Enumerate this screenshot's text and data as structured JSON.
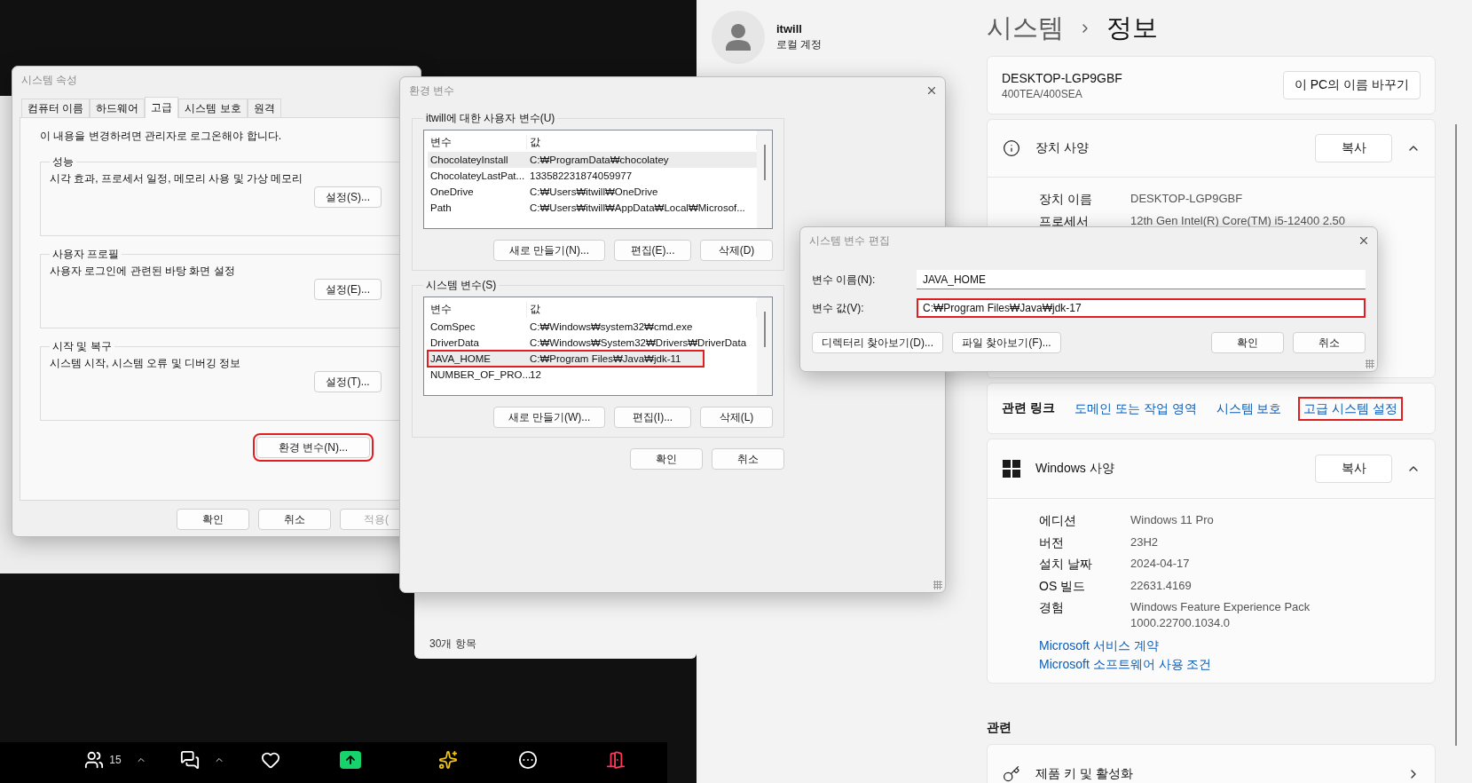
{
  "background_window": {
    "status": "30개 항목"
  },
  "system_properties": {
    "title": "시스템 속성",
    "tabs": [
      {
        "label": "컴퓨터 이름",
        "selected": false
      },
      {
        "label": "하드웨어",
        "selected": false
      },
      {
        "label": "고급",
        "selected": true
      },
      {
        "label": "시스템 보호",
        "selected": false
      },
      {
        "label": "원격",
        "selected": false
      }
    ],
    "notice": "이 내용을 변경하려면 관리자로 로그온해야 합니다.",
    "groups": [
      {
        "title": "성능",
        "description": "시각 효과, 프로세서 일정, 메모리 사용 및 가상 메모리",
        "button": "설정(S)..."
      },
      {
        "title": "사용자 프로필",
        "description": "사용자 로그인에 관련된 바탕 화면 설정",
        "button": "설정(E)..."
      },
      {
        "title": "시작 및 복구",
        "description": "시스템 시작, 시스템 오류 및 디버깅 정보",
        "button": "설정(T)..."
      }
    ],
    "env_button": {
      "label": "환경 변수(N)...",
      "highlighted": true
    },
    "buttons": [
      {
        "label": "확인",
        "disabled": false
      },
      {
        "label": "취소",
        "disabled": false
      },
      {
        "label": "적용(",
        "disabled": true
      }
    ]
  },
  "environment_variables": {
    "title": "환경 변수",
    "sections": [
      {
        "title": "itwill에 대한 사용자 변수(U)",
        "columns": [
          "변수",
          "값"
        ],
        "rows": [
          {
            "name": "ChocolateyInstall",
            "value": "C:₩ProgramData₩chocolatey",
            "selected": true,
            "highlighted": false
          },
          {
            "name": "ChocolateyLastPat...",
            "value": "133582231874059977",
            "selected": false,
            "highlighted": false
          },
          {
            "name": "OneDrive",
            "value": "C:₩Users₩itwill₩OneDrive",
            "selected": false,
            "highlighted": false
          },
          {
            "name": "Path",
            "value": "C:₩Users₩itwill₩AppData₩Local₩Microsof...",
            "selected": false,
            "highlighted": false
          }
        ],
        "buttons": [
          "새로 만들기(N)...",
          "편집(E)...",
          "삭제(D)"
        ]
      },
      {
        "title": "시스템 변수(S)",
        "columns": [
          "변수",
          "값"
        ],
        "rows": [
          {
            "name": "ComSpec",
            "value": "C:₩Windows₩system32₩cmd.exe",
            "selected": false,
            "highlighted": false
          },
          {
            "name": "DriverData",
            "value": "C:₩Windows₩System32₩Drivers₩DriverData",
            "selected": false,
            "highlighted": false
          },
          {
            "name": "JAVA_HOME",
            "value": "C:₩Program Files₩Java₩jdk-11",
            "selected": true,
            "highlighted": true
          },
          {
            "name": "NUMBER_OF_PRO...",
            "value": "12",
            "selected": false,
            "highlighted": false
          }
        ],
        "buttons": [
          "새로 만들기(W)...",
          "편집(I)...",
          "삭제(L)"
        ]
      }
    ],
    "buttons": [
      "확인",
      "취소"
    ]
  },
  "edit_dialog": {
    "title": "시스템 변수 편집",
    "fields": [
      {
        "label": "변수 이름(N):",
        "value": "JAVA_HOME",
        "highlighted": false
      },
      {
        "label": "변수 값(V):",
        "value": "C:₩Program Files₩Java₩jdk-17",
        "highlighted": true
      }
    ],
    "browse_buttons": [
      "디렉터리 찾아보기(D)...",
      "파일 찾아보기(F)..."
    ],
    "buttons": [
      "확인",
      "취소"
    ]
  },
  "settings": {
    "user": {
      "name": "itwill",
      "account": "로컬 계정"
    },
    "breadcrumb": [
      "시스템",
      "정보"
    ],
    "device": {
      "name": "DESKTOP-LGP9GBF",
      "model": "400TEA/400SEA",
      "rename_button": "이 PC의 이름 바꾸기"
    },
    "device_specs": {
      "title": "장치 사양",
      "copy_button": "복사",
      "expanded": true,
      "rows": [
        {
          "label": "장치 이름",
          "value": "DESKTOP-LGP9GBF"
        },
        {
          "label": "프로세서",
          "value": "12th Gen Intel(R) Core(TM) i5-12400 2.50"
        }
      ]
    },
    "related_links": {
      "title": "관련 링크",
      "links": [
        {
          "label": "도메인 또는 작업 영역",
          "highlighted": false
        },
        {
          "label": "시스템 보호",
          "highlighted": false
        },
        {
          "label": "고급 시스템 설정",
          "highlighted": true
        }
      ]
    },
    "windows_specs": {
      "title": "Windows 사양",
      "copy_button": "복사",
      "expanded": true,
      "rows": [
        {
          "label": "에디션",
          "value": "Windows 11 Pro"
        },
        {
          "label": "버전",
          "value": "23H2"
        },
        {
          "label": "설치 날짜",
          "value": "2024-04-17"
        },
        {
          "label": "OS 빌드",
          "value": "22631.4169"
        },
        {
          "label": "경험",
          "value": "Windows Feature Experience Pack 1000.22700.1034.0"
        }
      ],
      "links": [
        "Microsoft 서비스 계약",
        "Microsoft 소프트웨어 사용 조건"
      ]
    },
    "related": {
      "title": "관련",
      "items": [
        {
          "title": "제품 키 및 활성화"
        }
      ]
    }
  },
  "meeting_toolbar": {
    "items": [
      {
        "kind": "participants",
        "count": "15",
        "menu": true
      },
      {
        "kind": "chat",
        "menu": true
      },
      {
        "kind": "reactions",
        "menu": false
      },
      {
        "kind": "share",
        "menu": false
      },
      {
        "kind": "ai",
        "menu": false
      },
      {
        "kind": "more",
        "menu": false
      },
      {
        "kind": "leave",
        "menu": false
      }
    ]
  }
}
